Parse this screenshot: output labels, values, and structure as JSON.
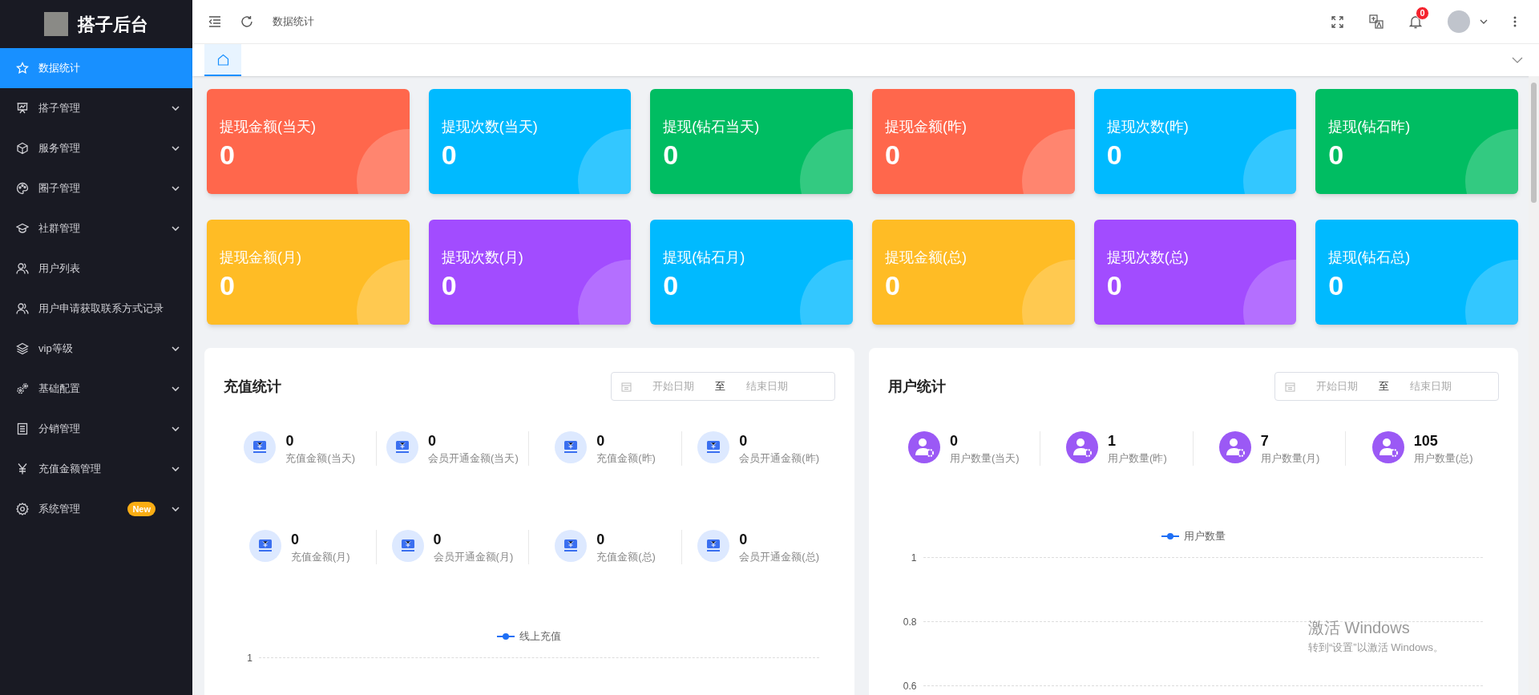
{
  "brand": {
    "title": "搭子后台"
  },
  "sidebar": {
    "items": [
      {
        "label": "数据统计",
        "selected": true,
        "expandable": false
      },
      {
        "label": "搭子管理",
        "selected": false,
        "expandable": true
      },
      {
        "label": "服务管理",
        "selected": false,
        "expandable": true
      },
      {
        "label": "圈子管理",
        "selected": false,
        "expandable": true
      },
      {
        "label": "社群管理",
        "selected": false,
        "expandable": true
      },
      {
        "label": "用户列表",
        "selected": false,
        "expandable": false
      },
      {
        "label": "用户申请获取联系方式记录",
        "selected": false,
        "expandable": false
      },
      {
        "label": "vip等级",
        "selected": false,
        "expandable": true
      },
      {
        "label": "基础配置",
        "selected": false,
        "expandable": true
      },
      {
        "label": "分销管理",
        "selected": false,
        "expandable": true
      },
      {
        "label": "充值金额管理",
        "selected": false,
        "expandable": true
      },
      {
        "label": "系统管理",
        "selected": false,
        "expandable": true,
        "badge": "New"
      }
    ]
  },
  "header": {
    "breadcrumb": "数据统计",
    "notification_count": "0"
  },
  "tabs": [
    {
      "kind": "home",
      "selected": true
    }
  ],
  "stat_cards": [
    {
      "label": "提现金额(当天)",
      "value": "0",
      "color": "#ff674c"
    },
    {
      "label": "提现次数(当天)",
      "value": "0",
      "color": "#00baff"
    },
    {
      "label": "提现(钻石当天)",
      "value": "0",
      "color": "#00bd62"
    },
    {
      "label": "提现金额(昨)",
      "value": "0",
      "color": "#ff674c"
    },
    {
      "label": "提现次数(昨)",
      "value": "0",
      "color": "#00baff"
    },
    {
      "label": "提现(钻石昨)",
      "value": "0",
      "color": "#00bd62"
    },
    {
      "label": "提现金额(月)",
      "value": "0",
      "color": "#ffbc25"
    },
    {
      "label": "提现次数(月)",
      "value": "0",
      "color": "#a24cff"
    },
    {
      "label": "提现(钻石月)",
      "value": "0",
      "color": "#00baff"
    },
    {
      "label": "提现金额(总)",
      "value": "0",
      "color": "#ffbc25"
    },
    {
      "label": "提现次数(总)",
      "value": "0",
      "color": "#a24cff"
    },
    {
      "label": "提现(钻石总)",
      "value": "0",
      "color": "#00baff"
    }
  ],
  "panels": [
    {
      "title": "充值统计",
      "date_range": {
        "start_placeholder": "开始日期",
        "separator": "至",
        "end_placeholder": "结束日期"
      },
      "stat_rows": [
        [
          {
            "kind": "money",
            "value": "0",
            "label": "充值金额(当天)"
          },
          {
            "kind": "money",
            "value": "0",
            "label": "会员开通金额(当天)"
          },
          {
            "kind": "money",
            "value": "0",
            "label": "充值金额(昨)"
          },
          {
            "kind": "money",
            "value": "0",
            "label": "会员开通金额(昨)"
          }
        ],
        [
          {
            "kind": "money",
            "value": "0",
            "label": "充值金额(月)"
          },
          {
            "kind": "money",
            "value": "0",
            "label": "会员开通金额(月)"
          },
          {
            "kind": "money",
            "value": "0",
            "label": "充值金额(总)"
          },
          {
            "kind": "money",
            "value": "0",
            "label": "会员开通金额(总)"
          }
        ]
      ],
      "chart": {
        "legend": "线上充值",
        "y_tick_labels": [
          "1"
        ]
      }
    },
    {
      "title": "用户统计",
      "date_range": {
        "start_placeholder": "开始日期",
        "separator": "至",
        "end_placeholder": "结束日期"
      },
      "stat_rows": [
        [
          {
            "kind": "user",
            "value": "0",
            "label": "用户数量(当天)"
          },
          {
            "kind": "user",
            "value": "1",
            "label": "用户数量(昨)"
          },
          {
            "kind": "user",
            "value": "7",
            "label": "用户数量(月)"
          },
          {
            "kind": "user",
            "value": "105",
            "label": "用户数量(总)"
          }
        ]
      ],
      "chart": {
        "legend": "用户数量",
        "y_tick_labels": [
          "1",
          "0.8",
          "0.6"
        ]
      }
    }
  ],
  "os_notice": {
    "title": "激活 Windows",
    "subtitle": "转到“设置”以激活 Windows。"
  }
}
